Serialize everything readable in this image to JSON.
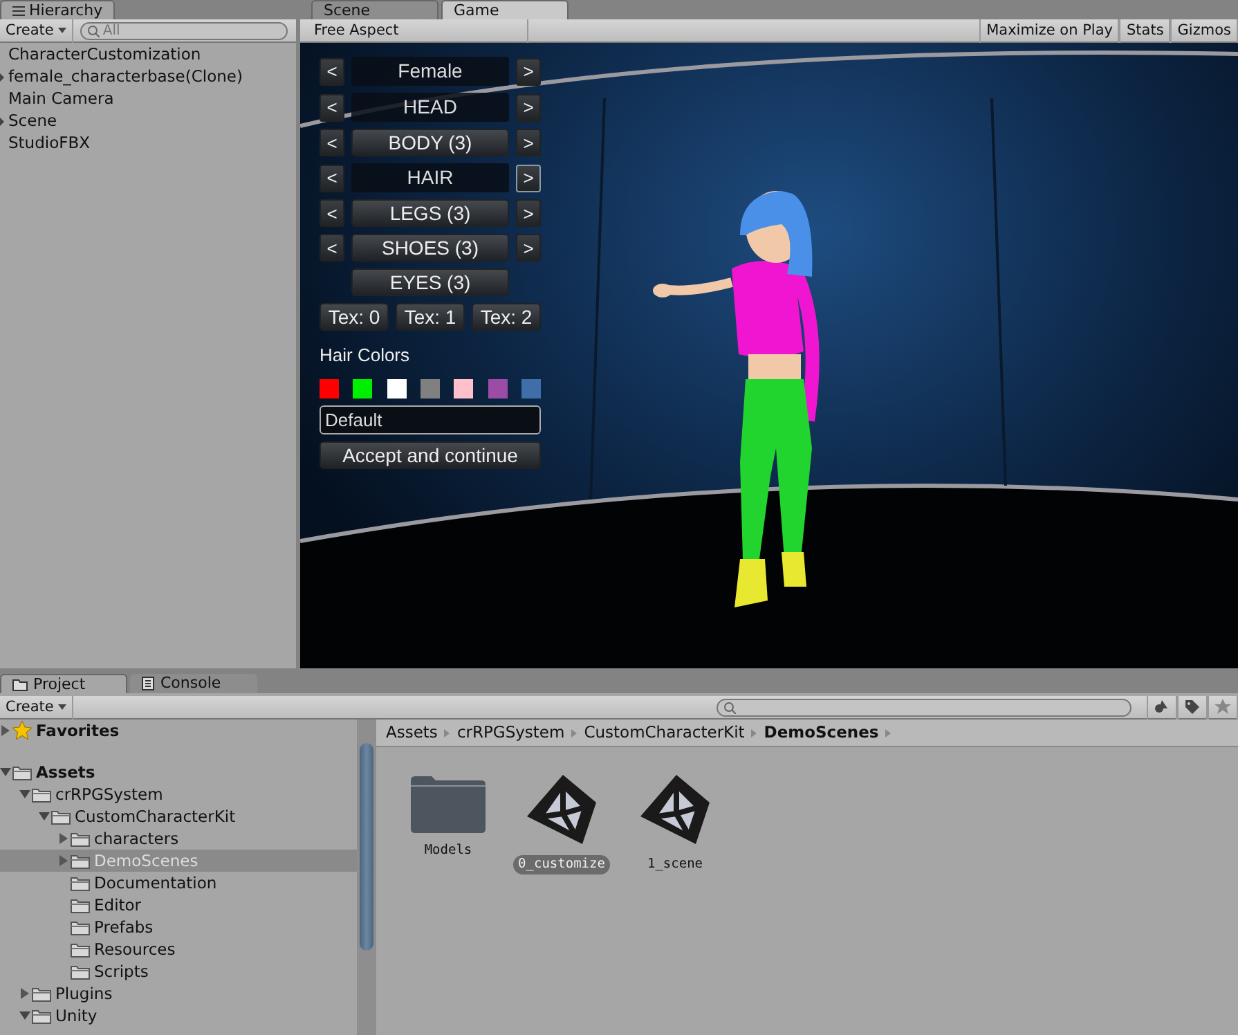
{
  "hierarchy": {
    "title": "Hierarchy",
    "create": "Create",
    "search": {
      "placeholder": "All"
    },
    "items": [
      {
        "label": "CharacterCustomization",
        "has_children": false
      },
      {
        "label": "female_characterbase(Clone)",
        "has_children": true
      },
      {
        "label": "Main Camera",
        "has_children": false
      },
      {
        "label": "Scene",
        "has_children": true
      },
      {
        "label": "StudioFBX",
        "has_children": false
      }
    ]
  },
  "game": {
    "tabs": [
      {
        "label": "Scene",
        "selected": false
      },
      {
        "label": "Game",
        "selected": true
      }
    ],
    "aspect": "Free Aspect",
    "toolbar": [
      "Maximize on Play",
      "Stats",
      "Gizmos"
    ],
    "menu": [
      {
        "label": "Female",
        "kind": "label",
        "prev": "<",
        "next": ">",
        "next_hover": false
      },
      {
        "label": "HEAD",
        "kind": "label",
        "prev": "<",
        "next": ">",
        "next_hover": false
      },
      {
        "label": "BODY (3)",
        "kind": "button",
        "prev": "<",
        "next": ">",
        "next_hover": false
      },
      {
        "label": "HAIR",
        "kind": "label",
        "prev": "<",
        "next": ">",
        "next_hover": true
      },
      {
        "label": "LEGS (3)",
        "kind": "button",
        "prev": "<",
        "next": ">",
        "next_hover": false
      },
      {
        "label": "SHOES (3)",
        "kind": "button",
        "prev": "<",
        "next": ">",
        "next_hover": false
      },
      {
        "label": "EYES (3)",
        "kind": "button"
      }
    ],
    "tex_buttons": [
      "Tex: 0",
      "Tex: 1",
      "Tex: 2"
    ],
    "hair_colors": {
      "label": "Hair Colors",
      "swatches": [
        {
          "color": "#ff0000"
        },
        {
          "color": "#00ee00"
        },
        {
          "color": "#ffffff"
        },
        {
          "color": "#808080"
        },
        {
          "color": "#ffc0cb"
        },
        {
          "color": "#9b4da6"
        },
        {
          "color": "#3f6ea8"
        }
      ]
    },
    "name_field": {
      "value": "Default"
    },
    "accept": "Accept and continue"
  },
  "project": {
    "tabs": [
      {
        "label": "Project",
        "selected": true
      },
      {
        "label": "Console",
        "selected": false
      }
    ],
    "create": "Create",
    "favorites": {
      "label": "Favorites",
      "expanded": false
    },
    "tree": [
      {
        "label": "Assets",
        "expanded": true,
        "selected": false,
        "children": [
          {
            "label": "crRPGSystem",
            "expanded": true,
            "selected": false,
            "children": [
              {
                "label": "CustomCharacterKit",
                "expanded": true,
                "selected": false,
                "children": [
                  {
                    "label": "characters",
                    "expanded": false,
                    "selected": false
                  },
                  {
                    "label": "DemoScenes",
                    "expanded": false,
                    "selected": true
                  },
                  {
                    "label": "Documentation",
                    "selected": false
                  },
                  {
                    "label": "Editor",
                    "selected": false
                  },
                  {
                    "label": "Prefabs",
                    "selected": false
                  },
                  {
                    "label": "Resources",
                    "selected": false
                  },
                  {
                    "label": "Scripts",
                    "selected": false
                  }
                ]
              }
            ]
          },
          {
            "label": "Plugins",
            "expanded": false,
            "selected": false
          },
          {
            "label": "Unity",
            "expanded": true,
            "selected": false
          }
        ]
      }
    ],
    "breadcrumb": [
      "Assets",
      "crRPGSystem",
      "CustomCharacterKit",
      "DemoScenes"
    ],
    "assets": [
      {
        "name": "Models",
        "kind": "folder",
        "selected": false
      },
      {
        "name": "0_customize",
        "kind": "scene",
        "selected": true
      },
      {
        "name": "1_scene",
        "kind": "scene",
        "selected": false
      }
    ]
  }
}
